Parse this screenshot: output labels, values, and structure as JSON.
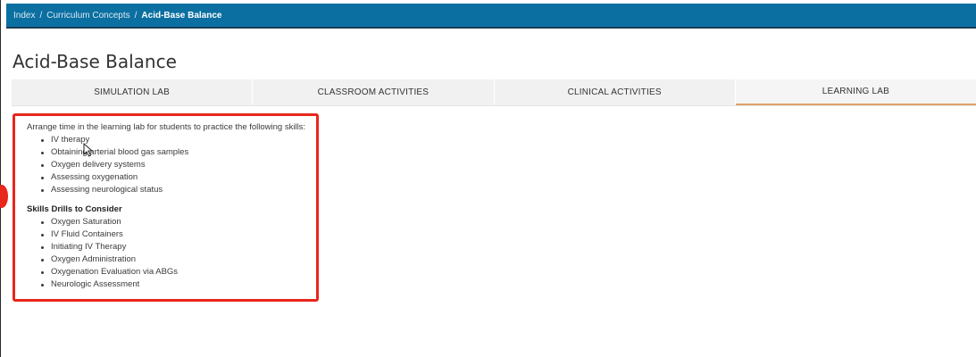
{
  "breadcrumb": {
    "items": [
      "Index",
      "Curriculum Concepts"
    ],
    "separator": "/",
    "current": "Acid-Base Balance"
  },
  "page": {
    "title": "Acid-Base Balance"
  },
  "tabs": [
    {
      "label": "SIMULATION LAB",
      "active": false
    },
    {
      "label": "CLASSROOM ACTIVITIES",
      "active": false
    },
    {
      "label": "CLINICAL ACTIVITIES",
      "active": false
    },
    {
      "label": "LEARNING LAB",
      "active": true
    }
  ],
  "content": {
    "intro": "Arrange time in the learning lab for students to practice the following skills:",
    "skills": [
      "IV therapy",
      "Obtaining arterial blood gas samples",
      "Oxygen delivery systems",
      "Assessing oxygenation",
      "Assessing neurological status"
    ],
    "drills_heading": "Skills Drills to Consider",
    "drills": [
      "Oxygen Saturation",
      "IV Fluid Containers",
      "Initiating IV Therapy",
      "Oxygen Administration",
      "Oxygenation Evaluation via ABGs",
      "Neurologic Assessment"
    ]
  },
  "colors": {
    "topbar": "#0b6fa1",
    "highlight_border": "#e8261c",
    "active_tab_underline": "#e0a26a",
    "tab_background": "#f1f1f1"
  },
  "icons": {
    "cursor": "mouse-pointer-icon"
  }
}
